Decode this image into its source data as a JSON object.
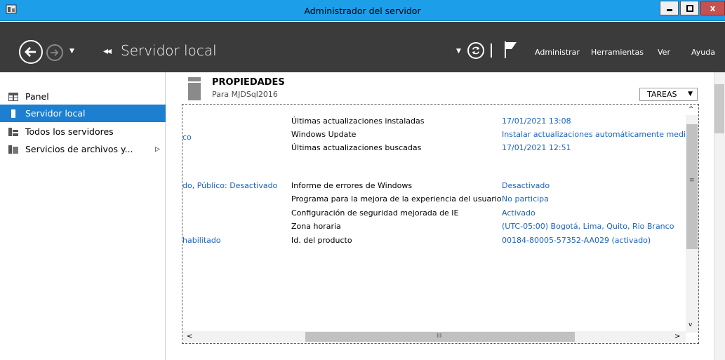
{
  "window": {
    "title": "Administrador del servidor",
    "close_label": "x"
  },
  "header": {
    "breadcrumb": "Servidor local",
    "menu": [
      {
        "label": "Administrar"
      },
      {
        "label": "Herramientas"
      },
      {
        "label": "Ver"
      },
      {
        "label": "Ayuda"
      }
    ]
  },
  "sidebar": {
    "items": [
      {
        "label": "Panel",
        "icon": "dashboard-icon"
      },
      {
        "label": "Servidor local",
        "icon": "server-icon",
        "selected": true
      },
      {
        "label": "Todos los servidores",
        "icon": "servers-icon"
      },
      {
        "label": "Servicios de archivos y...",
        "icon": "file-services-icon",
        "has_submenu": true
      }
    ]
  },
  "properties": {
    "title": "PROPIEDADES",
    "subtitle": "Para MJDSql2016",
    "tasks_label": "TAREAS",
    "left_fragments": [
      "co",
      "do, Público: Desactivado",
      "habilitado"
    ],
    "rows": [
      {
        "label": "Últimas actualizaciones instaladas",
        "value": "17/01/2021 13:08"
      },
      {
        "label": "Windows Update",
        "value": "Instalar actualizaciones automáticamente mediar"
      },
      {
        "label": "Últimas actualizaciones buscadas",
        "value": "17/01/2021 12:51"
      },
      {
        "label": "Informe de errores de Windows",
        "value": "Desactivado"
      },
      {
        "label": "Programa para la mejora de la experiencia del usuario",
        "value": "No participa"
      },
      {
        "label": "Configuración de seguridad mejorada de IE",
        "value": "Activado"
      },
      {
        "label": "Zona horaria",
        "value": "(UTC-05:00) Bogotá, Lima, Quito, Rio Branco"
      },
      {
        "label": "Id. del producto",
        "value": "00184-80005-57352-AA029 (activado)"
      }
    ]
  },
  "colors": {
    "titlebar": "#1c9ee8",
    "header": "#3b3b3b",
    "selection": "#1c7fd0",
    "link": "#1a63c3"
  }
}
